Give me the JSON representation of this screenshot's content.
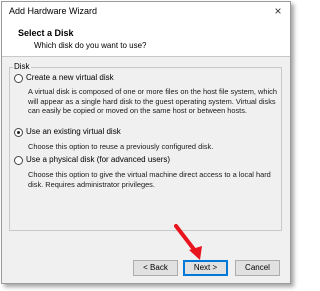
{
  "window": {
    "title": "Add Hardware Wizard",
    "close_glyph": "×"
  },
  "header": {
    "title": "Select a Disk",
    "subtitle": "Which disk do you want to use?"
  },
  "group": {
    "label": "Disk"
  },
  "options": [
    {
      "label": "Create a new virtual disk",
      "checked": false,
      "description": "A virtual disk is composed of one or more files on the host file system, which will appear as a single hard disk to the guest operating system. Virtual disks can easily be copied or moved on the same host or between hosts."
    },
    {
      "label": "Use an existing virtual disk",
      "checked": true,
      "description": "Choose this option to reuse a previously configured disk."
    },
    {
      "label": "Use a physical disk (for advanced users)",
      "checked": false,
      "description": "Choose this option to give the virtual machine direct access to a local hard disk. Requires administrator privileges."
    }
  ],
  "buttons": {
    "back": "< Back",
    "next": "Next >",
    "cancel": "Cancel"
  },
  "annotation": {
    "arrow_color": "#e8141e",
    "icon": "red-arrow-icon"
  }
}
